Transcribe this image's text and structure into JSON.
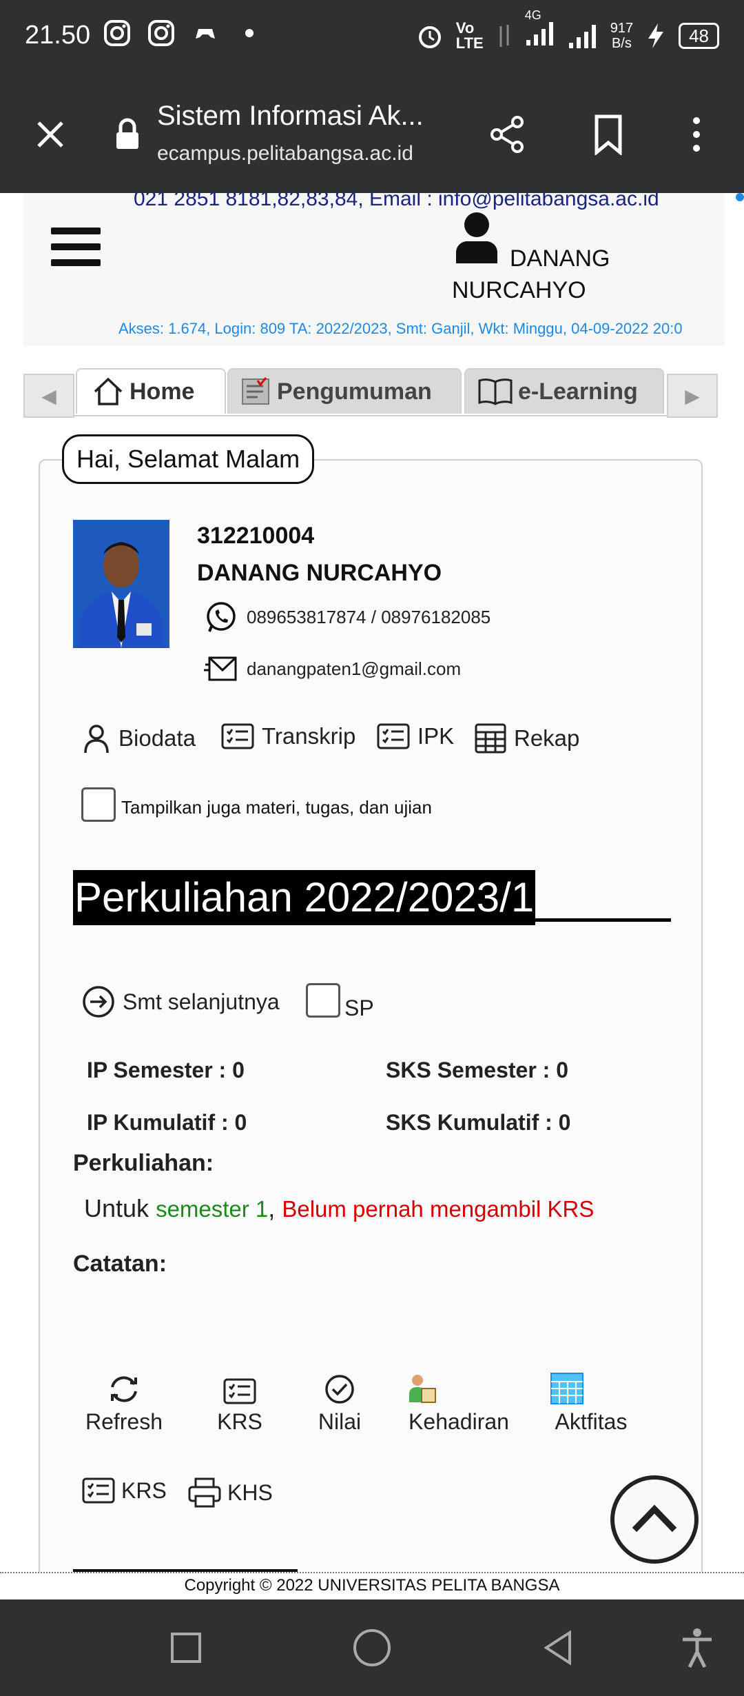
{
  "status_bar": {
    "time": "21.50",
    "network_label": "4G",
    "speed_top": "917",
    "speed_bottom": "B/s",
    "battery": "48",
    "icons": [
      "instagram-icon",
      "instagram-icon",
      "game-controller-icon",
      "dot-icon",
      "alarm-icon",
      "volte-icon",
      "data-arrows-icon",
      "signal-icon",
      "signal-icon",
      "charging-icon",
      "battery-icon"
    ]
  },
  "browser": {
    "title": "Sistem Informasi Ak...",
    "url": "ecampus.pelitabangsa.ac.id"
  },
  "header": {
    "contact": "021 2851 8181,82,83,84, Email : info@pelitabangsa.ac.id",
    "user_first": "DANANG",
    "user_last": "NURCAHYO",
    "access_info": "Akses: 1.674, Login: 809 TA: 2022/2023, Smt: Ganjil, Wkt: Minggu, 04-09-2022 20:0"
  },
  "tabs": [
    {
      "label": "Home",
      "active": true
    },
    {
      "label": "Pengumuman",
      "active": false
    },
    {
      "label": "e-Learning",
      "active": false
    }
  ],
  "profile": {
    "greeting": "Hai, Selamat Malam",
    "nim": "312210004",
    "name": "DANANG NURCAHYO",
    "phone": "089653817874 / 08976182085",
    "email": "danangpaten1@gmail.com"
  },
  "quick_links": [
    "Biodata",
    "Transkrip",
    "IPK",
    "Rekap"
  ],
  "show_materials_label": "Tampilkan juga materi, tugas, dan ujian",
  "lecture": {
    "title": "Perkuliahan 2022/2023/1",
    "next_semester": "Smt selanjutnya",
    "sp_label": "SP",
    "ip_semester": "IP Semester : 0",
    "sks_semester": "SKS Semester : 0",
    "ip_kumulatif": "IP Kumulatif : 0",
    "sks_kumulatif": "SKS Kumulatif : 0",
    "perkuliahan_label": "Perkuliahan:",
    "untuk": "Untuk",
    "semester": "semester 1",
    "comma": ",",
    "krs_status": "Belum pernah mengambil KRS",
    "catatan_label": "Catatan:"
  },
  "actions": [
    "Refresh",
    "KRS",
    "Nilai",
    "Kehadiran",
    "Aktfitas"
  ],
  "footer_actions": [
    "KRS",
    "KHS"
  ],
  "copyright": "Copyright © 2022 UNIVERSITAS PELITA BANGSA",
  "colors": {
    "bar_bg": "#2f3032",
    "link_blue": "#1e88e5",
    "navy": "#1a237e",
    "green": "#1b8a1b",
    "red": "#d50000"
  }
}
